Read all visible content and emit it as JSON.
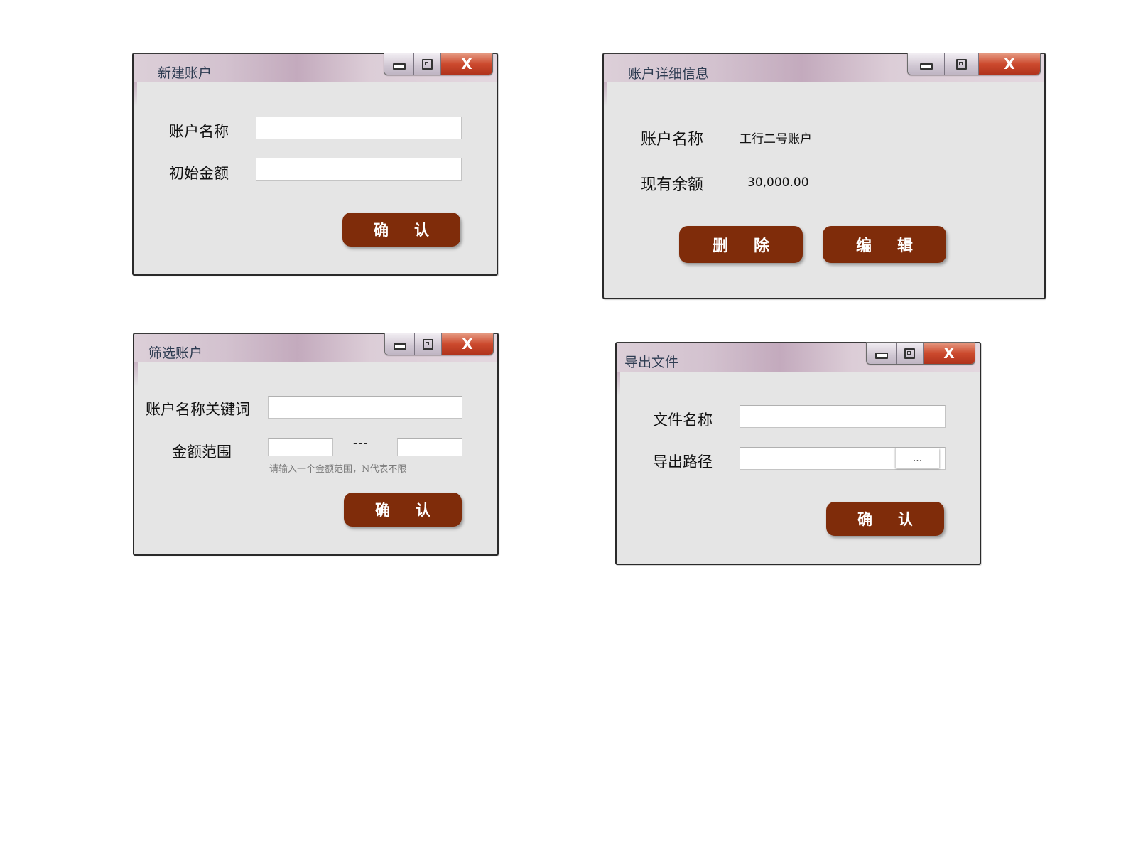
{
  "dialogs": {
    "new_account": {
      "title": "新建账户",
      "account_name_label": "账户名称",
      "initial_amount_label": "初始金额",
      "account_name_value": "",
      "initial_amount_value": "",
      "confirm_label": "确认"
    },
    "account_detail": {
      "title": "账户详细信息",
      "account_name_label": "账户名称",
      "account_name_value": "工行二号账户",
      "balance_label": "现有余额",
      "balance_value": "30,000.00",
      "delete_label": "删除",
      "edit_label": "编辑"
    },
    "filter_account": {
      "title": "筛选账户",
      "keyword_label": "账户名称关键词",
      "amount_range_label": "金额范围",
      "range_separator": "---",
      "range_hint": "请输入一个金额范围，N代表不限",
      "keyword_value": "",
      "min_value": "",
      "max_value": "",
      "confirm_label": "确认"
    },
    "export_file": {
      "title": "导出文件",
      "file_name_label": "文件名称",
      "export_path_label": "导出路径",
      "file_name_value": "",
      "export_path_value": "",
      "browse_label": "...",
      "confirm_label": "确认"
    }
  },
  "colors": {
    "button": "#7f2c0a",
    "dialog_bg": "#e5e5e5",
    "close_button": "#cc4a2e",
    "title_text": "#2e3c52"
  },
  "window_controls": {
    "minimize_icon": "minimize-icon",
    "maximize_icon": "maximize-icon",
    "close_glyph": "X"
  }
}
